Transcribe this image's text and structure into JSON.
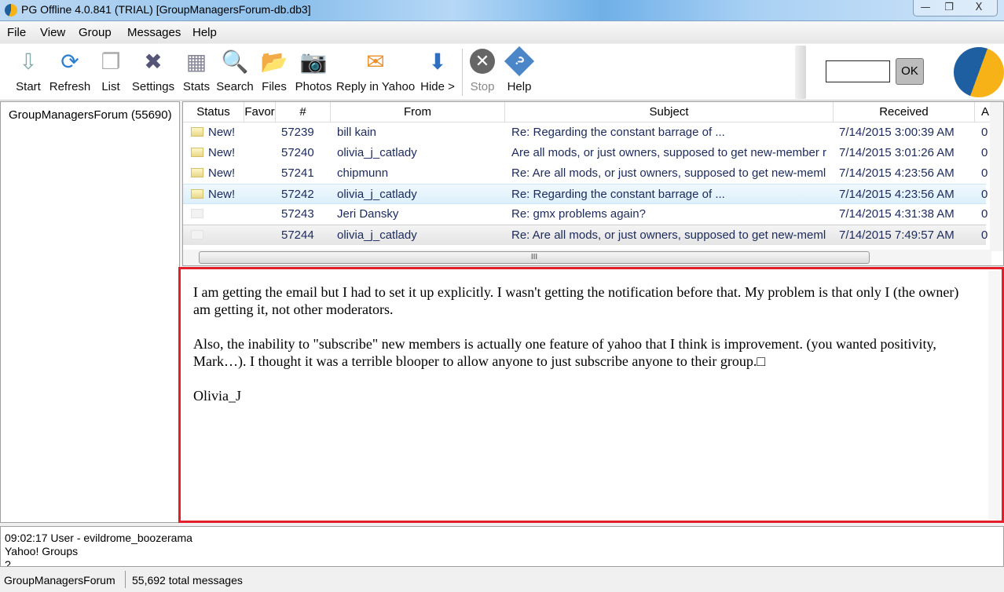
{
  "window": {
    "title": "PG Offline 4.0.841 (TRIAL) [GroupManagersForum-db.db3]",
    "minimize": "—",
    "restore": "❐",
    "close": "X"
  },
  "menu": [
    "File",
    "View",
    "Group",
    "Messages",
    "Help"
  ],
  "toolbar": {
    "buttons": [
      {
        "label": "Start",
        "icon": "start-icon",
        "glyph": "⇩"
      },
      {
        "label": "Refresh",
        "icon": "refresh-icon",
        "glyph": "⟳"
      },
      {
        "label": "List",
        "icon": "list-icon",
        "glyph": "❐"
      },
      {
        "label": "Settings",
        "icon": "settings-icon",
        "glyph": "✖"
      },
      {
        "label": "Stats",
        "icon": "stats-icon",
        "glyph": "▦"
      },
      {
        "label": "Search",
        "icon": "search-icon",
        "glyph": "🔍"
      },
      {
        "label": "Files",
        "icon": "folder-icon",
        "glyph": "📂"
      },
      {
        "label": "Photos",
        "icon": "camera-icon",
        "glyph": "📷"
      },
      {
        "label": "Reply in Yahoo",
        "icon": "reply-icon",
        "glyph": "✉"
      },
      {
        "label": "Hide >",
        "icon": "arrow-down-icon",
        "glyph": "⬇"
      },
      {
        "label": "Stop",
        "icon": "stop-icon",
        "glyph": "✕"
      },
      {
        "label": "Help",
        "icon": "help-icon",
        "glyph": "?"
      }
    ],
    "go_input_value": "",
    "ok_label": "OK"
  },
  "groups": [
    {
      "label": "GroupManagersForum (55690)"
    }
  ],
  "list": {
    "columns": [
      "Status",
      "Favor",
      "#",
      "From",
      "Subject",
      "Received",
      "A"
    ],
    "rows": [
      {
        "status": "New!",
        "read": false,
        "num": "57239",
        "from": "bill kain",
        "subject": "Re: Regarding the constant barrage of ...",
        "received": "7/14/2015 3:00:39 AM",
        "a": "0"
      },
      {
        "status": "New!",
        "read": false,
        "num": "57240",
        "from": "olivia_j_catlady",
        "subject": "Are all mods, or just owners, supposed to get new-member r",
        "received": "7/14/2015 3:01:26 AM",
        "a": "0"
      },
      {
        "status": "New!",
        "read": false,
        "num": "57241",
        "from": "chipmunn",
        "subject": "Re: Are all mods, or just owners, supposed to get new-meml",
        "received": "7/14/2015 4:23:56 AM",
        "a": "0"
      },
      {
        "status": "New!",
        "read": false,
        "num": "57242",
        "from": "olivia_j_catlady",
        "subject": "Re: Regarding the constant barrage of ...",
        "received": "7/14/2015 4:23:56 AM",
        "a": "0",
        "selected": true
      },
      {
        "status": "",
        "read": true,
        "num": "57243",
        "from": "Jeri Dansky",
        "subject": "Re: gmx problems again?",
        "received": "7/14/2015 4:31:38 AM",
        "a": "0"
      },
      {
        "status": "",
        "read": true,
        "num": "57244",
        "from": "olivia_j_catlady",
        "subject": "Re: Are all mods, or just owners, supposed to get new-meml",
        "received": "7/14/2015 7:49:57 AM",
        "a": "0",
        "current": true
      }
    ]
  },
  "message": {
    "paragraphs": [
      "I am getting the email but I had to set it up explicitly. I wasn't getting the notification before that. My problem is that only I (the owner) am getting it, not other moderators.",
      "Also, the inability to \"subscribe\" new members is actually one feature of yahoo that I think is improvement. (you wanted positivity, Mark…). I thought it was a terrible blooper to allow anyone to just subscribe anyone to their group.□",
      "Olivia_J"
    ],
    "highlight_color": "#e3202a"
  },
  "log": [
    "09:02:17 User - evildrome_boozerama",
    "Yahoo! Groups",
    "?"
  ],
  "status": {
    "group": "GroupManagersForum",
    "total": "55,692 total messages"
  }
}
